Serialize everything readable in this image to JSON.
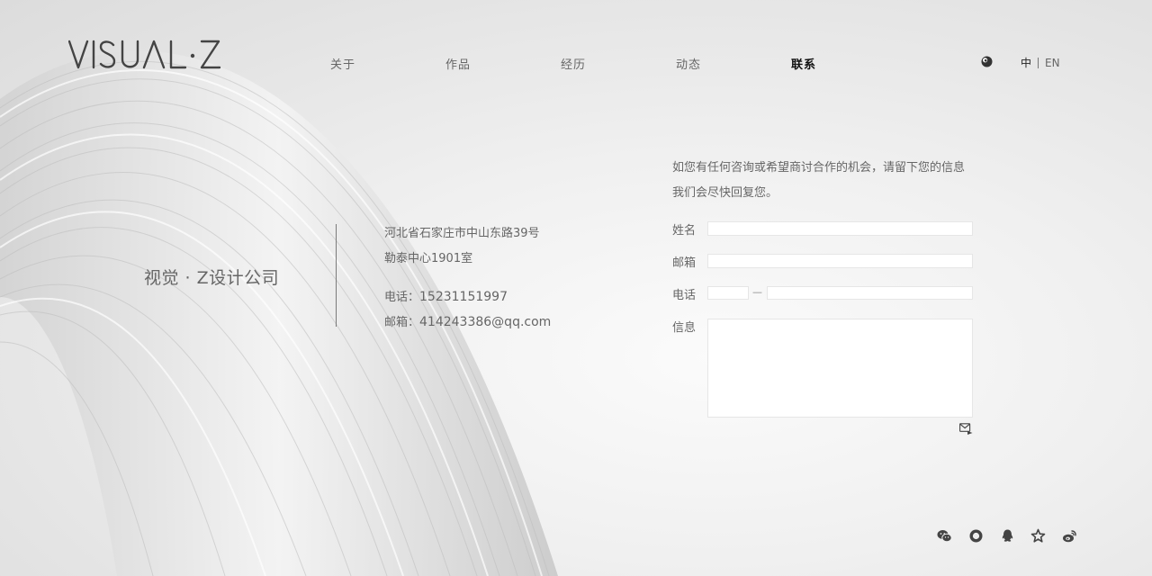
{
  "brand": {
    "logo_text": "VISUAL·Z"
  },
  "nav": {
    "items": [
      {
        "label": "关于",
        "active": false
      },
      {
        "label": "作品",
        "active": false
      },
      {
        "label": "经历",
        "active": false
      },
      {
        "label": "动态",
        "active": false
      },
      {
        "label": "联系",
        "active": true
      }
    ]
  },
  "lang": {
    "zh": "中",
    "en": "EN"
  },
  "company": {
    "name": "视觉 · Z设计公司",
    "address_line1": "河北省石家庄市中山东路39号",
    "address_line2": "勒泰中心1901室",
    "phone_label": "电话：",
    "phone": "15231151997",
    "email_label": "邮箱：",
    "email": "414243386@qq.com"
  },
  "form": {
    "intro_line1": "如您有任何咨询或希望商讨合作的机会，请留下您的信息",
    "intro_line2": "我们会尽快回复您。",
    "name_label": "姓名",
    "email_label": "邮箱",
    "phone_label": "电话",
    "phone_separator": "—",
    "message_label": "信息",
    "name_value": "",
    "email_value": "",
    "area_code_value": "",
    "phone_value": "",
    "message_value": ""
  },
  "icons": {
    "theme": "theme-toggle-icon",
    "send": "send-mail-icon",
    "social": [
      "wechat-icon",
      "circle-icon",
      "qq-icon",
      "star-icon",
      "weibo-icon"
    ]
  },
  "colors": {
    "background": "#ececec",
    "text": "#666666",
    "nav_active": "#111111",
    "input_bg": "#ffffff"
  }
}
